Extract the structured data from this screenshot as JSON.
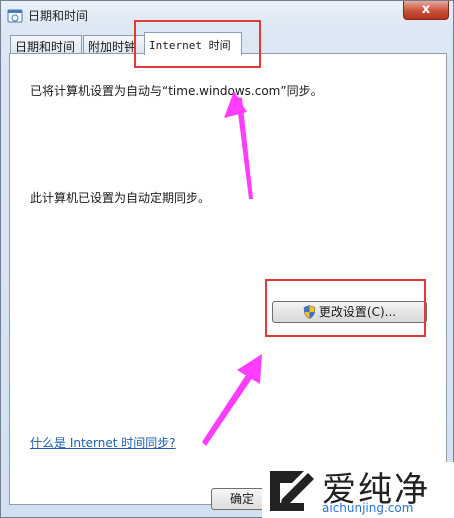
{
  "window": {
    "title": "日期和时间",
    "close_label": "x"
  },
  "tabs": [
    {
      "label": "日期和时间"
    },
    {
      "label": "附加时钟"
    },
    {
      "label": "Internet 时间"
    }
  ],
  "internet_time": {
    "sync_message": "已将计算机设置为自动与“time.windows.com”同步。",
    "schedule_message": "此计算机已设置为自动定期同步。",
    "change_button_label": "更改设置(C)...",
    "help_link": "什么是 Internet 时间同步?"
  },
  "footer": {
    "ok_label": "确定"
  },
  "annotations": {
    "highlight_color": "#e53935",
    "arrow_color": "#ff3cff"
  },
  "watermark": {
    "brand": "爱纯净",
    "url": "aichunjing.com",
    "url_color": "#2b73d6"
  }
}
